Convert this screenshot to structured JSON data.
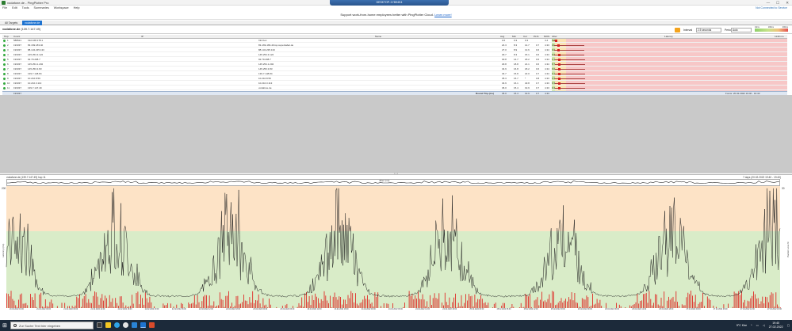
{
  "window": {
    "title": "vodafone.de - PingPlotter Pro",
    "controls": [
      "—",
      "☐",
      "✕"
    ],
    "remote_bar": "DESKTOP-1Y8H4K4"
  },
  "menu": [
    "File",
    "Edit",
    "Tools",
    "Summaries",
    "Workspace",
    "Help"
  ],
  "not_connected": "Not Connected to Service",
  "banner": {
    "text": "Support work-from-home employees better with PingPlotter Cloud.",
    "link": "Learn more!"
  },
  "tabs": {
    "all": "All Targets",
    "active": "vodafone.de"
  },
  "address": {
    "target": "vodafone.de",
    "ip": "(139.7.147.49)"
  },
  "toolbar": {
    "interval_label": "Interval",
    "interval_value": "2.5 seconds",
    "period_label": "Period",
    "period_value": "Auto",
    "legend_low": "10ms",
    "legend_mid": "100ms",
    "legend_high": "200ms"
  },
  "columns": [
    "Hop",
    "Count",
    "IP",
    "Name",
    "Avg",
    "Min",
    "Cur",
    "PL%",
    "MOS",
    "Jitter",
    "Latency"
  ],
  "latency_axis_right": "1140 ms",
  "hops": [
    {
      "hop": "1",
      "count": "588621",
      "ip": "192.168.178.1",
      "name": "fritz.box",
      "avg": "0.6",
      "min": "0.3",
      "cur": "0.3",
      "pl": "",
      "mos": "4.4",
      "jit": "0.1"
    },
    {
      "hop": "2",
      "count": "193337",
      "ip": "83.169.183.40",
      "name": "83-169-183-40.isp.superkabel.de",
      "avg": "24.3",
      "min": "8.3",
      "cur": "14.7",
      "pl": "0.7",
      "mos": "4.33",
      "jit": "10"
    },
    {
      "hop": "3",
      "count": "193337",
      "ip": "88.134.235.133",
      "name": "88.134.235.133",
      "avg": "27.0",
      "min": "8.9",
      "cur": "13.6",
      "pl": "0.6",
      "mos": "4.34",
      "jit": "9.0"
    },
    {
      "hop": "4",
      "count": "193337",
      "ip": "145.254.3.122",
      "name": "145.254.3.122",
      "avg": "29.7",
      "min": "8.3",
      "cur": "15.1",
      "pl": "0.6",
      "mos": "4.34",
      "jit": "8.6"
    },
    {
      "hop": "5",
      "count": "193337",
      "ip": "92.79.208.7",
      "name": "92.79.208.7",
      "avg": "30.8",
      "min": "14.7",
      "cur": "18.2",
      "pl": "0.6",
      "mos": "4.34",
      "jit": "9.1"
    },
    {
      "hop": "6",
      "count": "193337",
      "ip": "145.254.1.202",
      "name": "145.254.1.202",
      "avg": "29.8",
      "min": "18.8",
      "cur": "21.1",
      "pl": "0.6",
      "mos": "4.34",
      "jit": "8.7"
    },
    {
      "hop": "7",
      "count": "193337",
      "ip": "145.253.3.83",
      "name": "145.253.3.83",
      "avg": "34.9",
      "min": "16.8",
      "cur": "18.2",
      "pl": "0.6",
      "mos": "4.34",
      "jit": "9.0"
    },
    {
      "hop": "8",
      "count": "193337",
      "ip": "139.7.148.84",
      "name": "139.7.148.84",
      "avg": "34.7",
      "min": "15.8",
      "cur": "22.0",
      "pl": "0.7",
      "mos": "4.34",
      "jit": "9.1"
    },
    {
      "hop": "9",
      "count": "193337",
      "ip": "10.210.8.59",
      "name": "10.210.8.59",
      "avg": "35.3",
      "min": "15.7",
      "cur": "*",
      "pl": "0.8",
      "mos": "4.33",
      "jit": "9.3"
    },
    {
      "hop": "10",
      "count": "193337",
      "ip": "10.210.3.113",
      "name": "10.210.3.113",
      "avg": "34.9",
      "min": "16.1",
      "cur": "40.8",
      "pl": "0.7",
      "mos": "4.33",
      "jit": "9.3"
    },
    {
      "hop": "11",
      "count": "193337",
      "ip": "139.7.147.49",
      "name": "vodafone.de",
      "avg": "36.0",
      "min": "15.4",
      "cur": "19.9",
      "pl": "0.7",
      "mos": "4.33",
      "jit": "9.3"
    }
  ],
  "round_trip": {
    "count": "193337",
    "label": "Round Trip (ms)",
    "avg": "36.0",
    "min": "15.4",
    "cur": "19.9",
    "pl": "0.7",
    "mos": "4.33",
    "focus": "Focus: 20.02.2022 19:40 - 19:40"
  },
  "splitter": "• • •",
  "timeline": {
    "title": "vodafone.de (139.7.147.49) hop 11",
    "range": "7 days (20.02.2022 19:40 - 19:40)",
    "overview_label": "Jitter (ms)",
    "y_left_top": "200",
    "y_right_top": "30",
    "y_axis_label": "Latency (ms)",
    "pl_axis_label": "Packet Loss %",
    "x_ticks": [
      "20.02.2022 19:00",
      "21.02.2022 00:00",
      "21.02.2022 06:00",
      "21.02.2022 12:00",
      "21.02.2022 18:00",
      "22.02.2022 00:00",
      "22.02.2022 06:00",
      "22.02.2022 12:00",
      "22.02.2022 18:00",
      "23.02.2022 00:00",
      "23.02.2022 06:00",
      "23.02.2022 12:00",
      "23.02.2022 18:00",
      "24.02.2022 00:00",
      "24.02.2022 06:00",
      "24.02.2022 12:00",
      "24.02.2022 18:00",
      "25.02.2022 00:00",
      "25.02.2022 06:00",
      "25.02.2022 12:00",
      "25.02.2022 18:00",
      "26.02.2022 00:00",
      "26.02.2022 06:00",
      "26.02.2022 12:00",
      "26.02.2022 18:00",
      "27.02.2022 00:00",
      "27.02.2022 06:00",
      "27.02.2022 12:00",
      "27.02.2022 18:00"
    ],
    "colors": {
      "green": "#d9ecc8",
      "orange": "#fde3c6",
      "latency_line": "#222222",
      "loss": "#e01515"
    }
  },
  "taskbar": {
    "search_placeholder": "Zur Suche Text hier eingeben",
    "weather": "5°C  Klar",
    "time": "19:40",
    "date": "27.02.2022"
  }
}
